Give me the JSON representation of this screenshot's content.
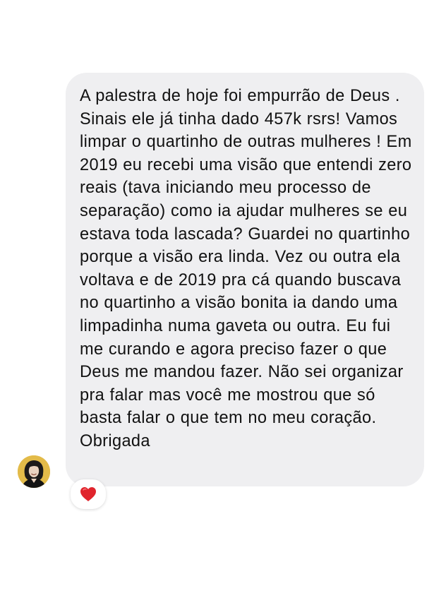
{
  "conversation": {
    "message": {
      "text": "A palestra de hoje foi empurrão de Deus . Sinais ele já tinha dado 457k rsrs! Vamos limpar o quartinho de outras mulheres ! Em 2019 eu recebi uma visão que entendi zero reais (tava iniciando meu processo de separação) como ia ajudar mulheres se eu estava toda lascada? Guardei no quartinho porque a visão era linda. Vez ou outra ela voltava e de 2019 pra cá quando buscava no quartinho a visão bonita ia dando uma limpadinha numa gaveta ou outra. Eu fui me curando e agora preciso fazer o que Deus me mandou fazer. Não sei organizar pra falar mas você me mostrou que só basta falar o que tem no meu coração. Obrigada",
      "bubble_color": "#efeff1",
      "text_color": "#111111"
    },
    "sender_avatar": {
      "icon": "person-avatar-icon",
      "background_color": "#e3bb49"
    },
    "reaction": {
      "icon": "red-heart-icon",
      "color": "#e0242c"
    }
  }
}
